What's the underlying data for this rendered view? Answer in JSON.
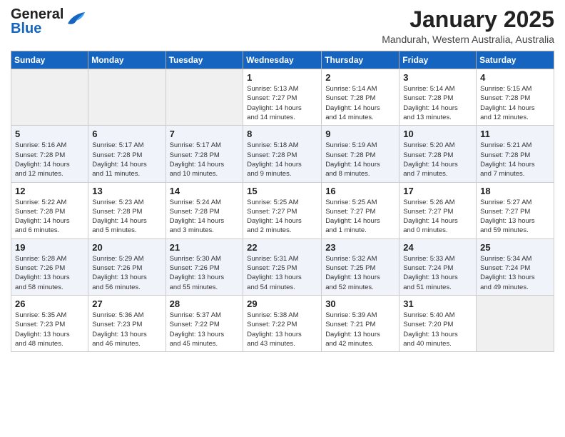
{
  "header": {
    "logo_general": "General",
    "logo_blue": "Blue",
    "month_title": "January 2025",
    "location": "Mandurah, Western Australia, Australia"
  },
  "weekdays": [
    "Sunday",
    "Monday",
    "Tuesday",
    "Wednesday",
    "Thursday",
    "Friday",
    "Saturday"
  ],
  "weeks": [
    [
      {
        "day": "",
        "info": ""
      },
      {
        "day": "",
        "info": ""
      },
      {
        "day": "",
        "info": ""
      },
      {
        "day": "1",
        "info": "Sunrise: 5:13 AM\nSunset: 7:27 PM\nDaylight: 14 hours\nand 14 minutes."
      },
      {
        "day": "2",
        "info": "Sunrise: 5:14 AM\nSunset: 7:28 PM\nDaylight: 14 hours\nand 14 minutes."
      },
      {
        "day": "3",
        "info": "Sunrise: 5:14 AM\nSunset: 7:28 PM\nDaylight: 14 hours\nand 13 minutes."
      },
      {
        "day": "4",
        "info": "Sunrise: 5:15 AM\nSunset: 7:28 PM\nDaylight: 14 hours\nand 12 minutes."
      }
    ],
    [
      {
        "day": "5",
        "info": "Sunrise: 5:16 AM\nSunset: 7:28 PM\nDaylight: 14 hours\nand 12 minutes."
      },
      {
        "day": "6",
        "info": "Sunrise: 5:17 AM\nSunset: 7:28 PM\nDaylight: 14 hours\nand 11 minutes."
      },
      {
        "day": "7",
        "info": "Sunrise: 5:17 AM\nSunset: 7:28 PM\nDaylight: 14 hours\nand 10 minutes."
      },
      {
        "day": "8",
        "info": "Sunrise: 5:18 AM\nSunset: 7:28 PM\nDaylight: 14 hours\nand 9 minutes."
      },
      {
        "day": "9",
        "info": "Sunrise: 5:19 AM\nSunset: 7:28 PM\nDaylight: 14 hours\nand 8 minutes."
      },
      {
        "day": "10",
        "info": "Sunrise: 5:20 AM\nSunset: 7:28 PM\nDaylight: 14 hours\nand 7 minutes."
      },
      {
        "day": "11",
        "info": "Sunrise: 5:21 AM\nSunset: 7:28 PM\nDaylight: 14 hours\nand 7 minutes."
      }
    ],
    [
      {
        "day": "12",
        "info": "Sunrise: 5:22 AM\nSunset: 7:28 PM\nDaylight: 14 hours\nand 6 minutes."
      },
      {
        "day": "13",
        "info": "Sunrise: 5:23 AM\nSunset: 7:28 PM\nDaylight: 14 hours\nand 5 minutes."
      },
      {
        "day": "14",
        "info": "Sunrise: 5:24 AM\nSunset: 7:28 PM\nDaylight: 14 hours\nand 3 minutes."
      },
      {
        "day": "15",
        "info": "Sunrise: 5:25 AM\nSunset: 7:27 PM\nDaylight: 14 hours\nand 2 minutes."
      },
      {
        "day": "16",
        "info": "Sunrise: 5:25 AM\nSunset: 7:27 PM\nDaylight: 14 hours\nand 1 minute."
      },
      {
        "day": "17",
        "info": "Sunrise: 5:26 AM\nSunset: 7:27 PM\nDaylight: 14 hours\nand 0 minutes."
      },
      {
        "day": "18",
        "info": "Sunrise: 5:27 AM\nSunset: 7:27 PM\nDaylight: 13 hours\nand 59 minutes."
      }
    ],
    [
      {
        "day": "19",
        "info": "Sunrise: 5:28 AM\nSunset: 7:26 PM\nDaylight: 13 hours\nand 58 minutes."
      },
      {
        "day": "20",
        "info": "Sunrise: 5:29 AM\nSunset: 7:26 PM\nDaylight: 13 hours\nand 56 minutes."
      },
      {
        "day": "21",
        "info": "Sunrise: 5:30 AM\nSunset: 7:26 PM\nDaylight: 13 hours\nand 55 minutes."
      },
      {
        "day": "22",
        "info": "Sunrise: 5:31 AM\nSunset: 7:25 PM\nDaylight: 13 hours\nand 54 minutes."
      },
      {
        "day": "23",
        "info": "Sunrise: 5:32 AM\nSunset: 7:25 PM\nDaylight: 13 hours\nand 52 minutes."
      },
      {
        "day": "24",
        "info": "Sunrise: 5:33 AM\nSunset: 7:24 PM\nDaylight: 13 hours\nand 51 minutes."
      },
      {
        "day": "25",
        "info": "Sunrise: 5:34 AM\nSunset: 7:24 PM\nDaylight: 13 hours\nand 49 minutes."
      }
    ],
    [
      {
        "day": "26",
        "info": "Sunrise: 5:35 AM\nSunset: 7:23 PM\nDaylight: 13 hours\nand 48 minutes."
      },
      {
        "day": "27",
        "info": "Sunrise: 5:36 AM\nSunset: 7:23 PM\nDaylight: 13 hours\nand 46 minutes."
      },
      {
        "day": "28",
        "info": "Sunrise: 5:37 AM\nSunset: 7:22 PM\nDaylight: 13 hours\nand 45 minutes."
      },
      {
        "day": "29",
        "info": "Sunrise: 5:38 AM\nSunset: 7:22 PM\nDaylight: 13 hours\nand 43 minutes."
      },
      {
        "day": "30",
        "info": "Sunrise: 5:39 AM\nSunset: 7:21 PM\nDaylight: 13 hours\nand 42 minutes."
      },
      {
        "day": "31",
        "info": "Sunrise: 5:40 AM\nSunset: 7:20 PM\nDaylight: 13 hours\nand 40 minutes."
      },
      {
        "day": "",
        "info": ""
      }
    ]
  ]
}
